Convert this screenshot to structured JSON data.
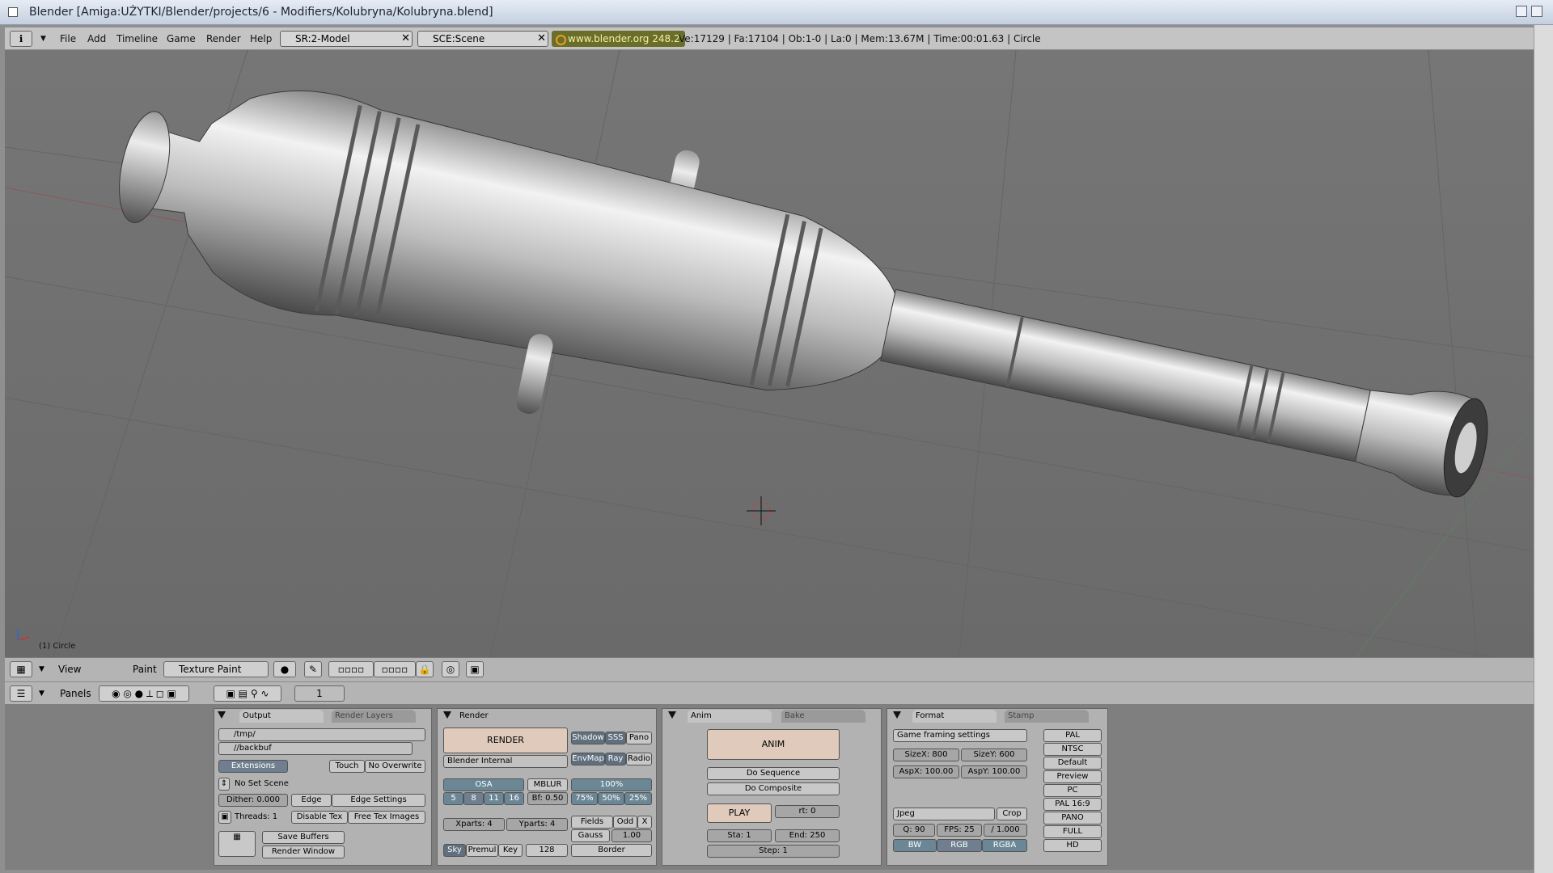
{
  "window": {
    "title": "Blender [Amiga:UŻYTKI/Blender/projects/6 - Modifiers/Kolubryna/Kolubryna.blend]"
  },
  "infobar": {
    "menus": [
      "File",
      "Add",
      "Timeline",
      "Game",
      "Render",
      "Help"
    ],
    "screen": "SR:2-Model",
    "scene": "SCE:Scene",
    "website": "www.blender.org 248.2",
    "stats": "Ve:17129 | Fa:17104 | Ob:1-0 | La:0  | Mem:13.67M  | Time:00:01.63 | Circle"
  },
  "viewport": {
    "object_label": "(1) Circle"
  },
  "view_header": {
    "view": "View",
    "mode_label": "Paint",
    "mode_value": "Texture Paint"
  },
  "buttons_header": {
    "panels": "Panels",
    "frame": "1"
  },
  "output_panel": {
    "tabs": [
      "Output",
      "Render Layers"
    ],
    "path1": "/tmp/",
    "path2": "//backbuf",
    "extensions": "Extensions",
    "touch": "Touch",
    "no_overwrite": "No Overwrite",
    "no_set_scene": "No Set Scene",
    "dither": "Dither: 0.000",
    "edge": "Edge",
    "edge_settings": "Edge Settings",
    "threads": "Threads: 1",
    "disable_tex": "Disable Tex",
    "free_tex": "Free Tex Images",
    "save_buffers": "Save Buffers",
    "render_window": "Render Window"
  },
  "render_panel": {
    "title": "Render",
    "render_btn": "RENDER",
    "engine": "Blender Internal",
    "shadow": "Shadow",
    "sss": "SSS",
    "pano": "Pano",
    "envmap": "EnvMap",
    "ray": "Ray",
    "radio": "Radio",
    "osa": "OSA",
    "mblur": "MBLUR",
    "pct100": "100%",
    "osa_vals": [
      "5",
      "8",
      "11",
      "16"
    ],
    "bf": "Bf: 0.50",
    "pcts": [
      "75%",
      "50%",
      "25%"
    ],
    "xparts": "Xparts: 4",
    "yparts": "Yparts: 4",
    "fields": "Fields",
    "odd": "Odd",
    "x": "X",
    "gauss": "Gauss",
    "gauss_val": "1.00",
    "sky": "Sky",
    "premul": "Premul",
    "key": "Key",
    "depth": "128",
    "border": "Border"
  },
  "anim_panel": {
    "tabs": [
      "Anim",
      "Bake"
    ],
    "anim": "ANIM",
    "do_sequence": "Do Sequence",
    "do_composite": "Do Composite",
    "play": "PLAY",
    "rt": "rt: 0",
    "sta": "Sta: 1",
    "end": "End: 250",
    "step": "Step: 1"
  },
  "format_panel": {
    "tabs": [
      "Format",
      "Stamp"
    ],
    "game_framing": "Game framing settings",
    "sizex": "SizeX: 800",
    "sizey": "SizeY: 600",
    "aspx": "AspX: 100.00",
    "aspy": "AspY: 100.00",
    "codec": "Jpeg",
    "crop": "Crop",
    "q": "Q: 90",
    "fps": "FPS: 25",
    "fpsb": "/ 1.000",
    "bw": "BW",
    "rgb": "RGB",
    "rgba": "RGBA",
    "presets": [
      "PAL",
      "NTSC",
      "Default",
      "Preview",
      "PC",
      "PAL 16:9",
      "PANO",
      "FULL",
      "HD"
    ]
  }
}
